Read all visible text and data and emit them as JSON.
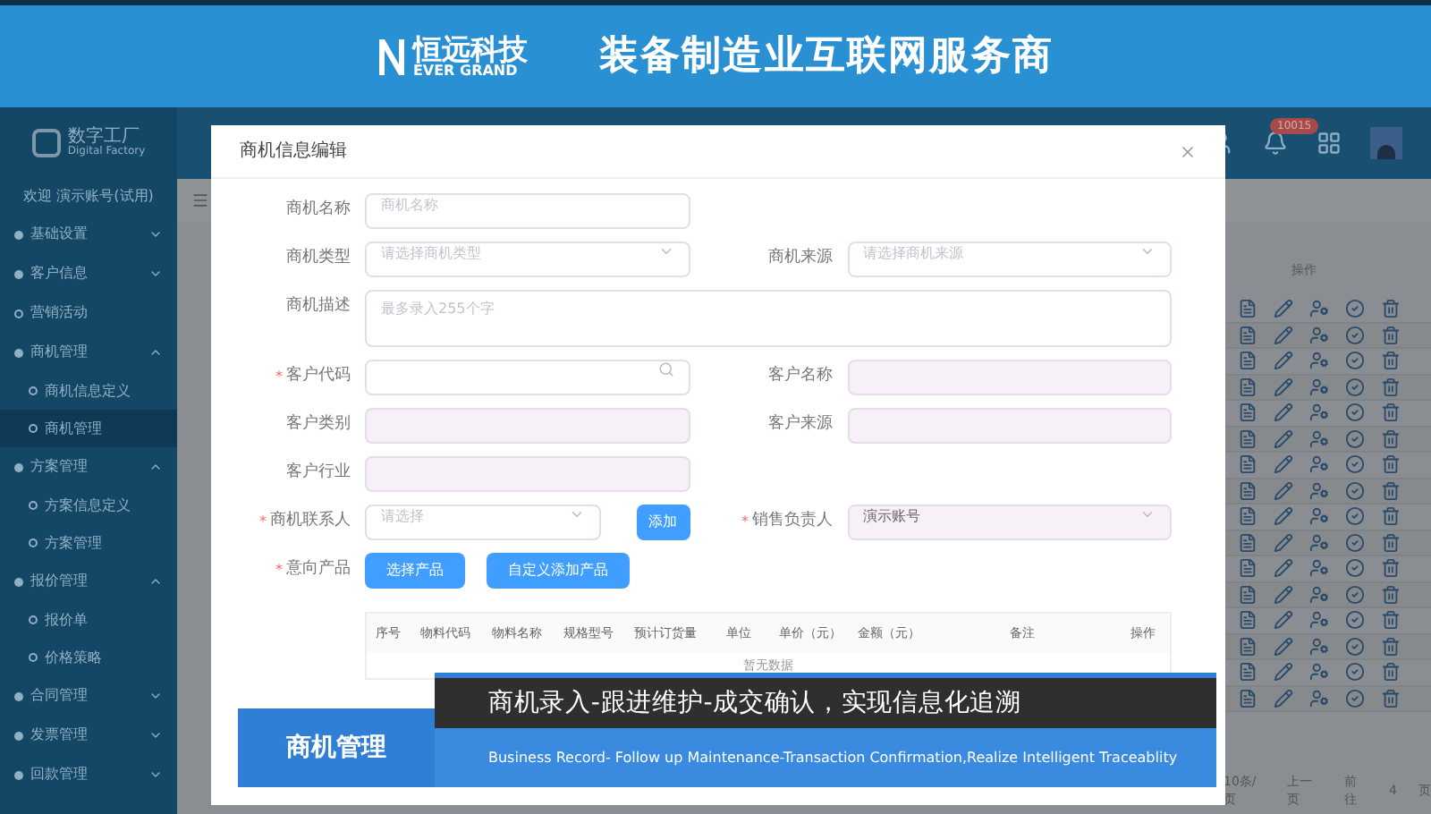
{
  "banner": {
    "logo_name": "恒远科技",
    "logo_sub": "EVER GRAND",
    "slogan": "装备制造业互联网服务商"
  },
  "app": {
    "name": "数字工厂",
    "name_en": "Digital Factory",
    "welcome": "欢迎 演示账号(试用)"
  },
  "header": {
    "badge": "10015"
  },
  "sidebar": {
    "items": [
      {
        "label": "基础设置",
        "expanded": false
      },
      {
        "label": "客户信息",
        "expanded": false
      },
      {
        "label": "营销活动",
        "kind": "leaf"
      },
      {
        "label": "商机管理",
        "expanded": true,
        "children": [
          {
            "label": "商机信息定义",
            "selected": false
          },
          {
            "label": "商机管理",
            "selected": true
          }
        ]
      },
      {
        "label": "方案管理",
        "expanded": true,
        "children": [
          {
            "label": "方案信息定义",
            "selected": false
          },
          {
            "label": "方案管理",
            "selected": false
          }
        ]
      },
      {
        "label": "报价管理",
        "expanded": true,
        "children": [
          {
            "label": "报价单",
            "selected": false
          },
          {
            "label": "价格策略",
            "selected": false
          }
        ]
      },
      {
        "label": "合同管理",
        "expanded": false
      },
      {
        "label": "发票管理",
        "expanded": false
      },
      {
        "label": "回款管理",
        "expanded": false
      }
    ]
  },
  "list": {
    "action_header": "操作",
    "pagination": {
      "page_size": "10条/页",
      "prev": "上一页",
      "goto": "前往",
      "page": "4",
      "page_suffix": "页"
    }
  },
  "dialog": {
    "title": "商机信息编辑",
    "rows": [
      [
        {
          "kind": "input",
          "label": "商机名称",
          "placeholder": "商机名称",
          "disabled": false
        }
      ],
      [
        {
          "kind": "select",
          "label": "商机类型",
          "placeholder": "请选择商机类型",
          "disabled": false
        },
        {
          "kind": "select",
          "label": "商机来源",
          "placeholder": "请选择商机来源",
          "disabled": false
        }
      ],
      [
        {
          "kind": "textarea",
          "label": "商机描述",
          "placeholder": "最多录入255个字",
          "disabled": false
        }
      ],
      [
        {
          "kind": "search",
          "label": "客户代码",
          "required": "*",
          "disabled": false
        },
        {
          "kind": "input",
          "label": "客户名称",
          "disabled": true
        }
      ],
      [
        {
          "kind": "input",
          "label": "客户类别",
          "disabled": true
        },
        {
          "kind": "input",
          "label": "客户来源",
          "disabled": true
        }
      ],
      [
        {
          "kind": "input",
          "label": "客户行业",
          "disabled": true
        }
      ],
      [
        {
          "kind": "select",
          "label": "商机联系人",
          "placeholder": "请选择",
          "required": "*",
          "disabled": false,
          "button": "添加"
        },
        {
          "kind": "select",
          "label": "销售负责人",
          "value": "演示账号",
          "required": "*",
          "disabled": true
        }
      ],
      [
        {
          "kind": "buttons",
          "label": "意向产品",
          "required": "*",
          "buttons": [
            "选择产品",
            "自定义添加产品"
          ]
        }
      ]
    ],
    "table": {
      "columns": [
        "序号",
        "物料代码",
        "物料名称",
        "规格型号",
        "预计订货量",
        "单位",
        "单价（元）",
        "金额（元）",
        "备注",
        "操作"
      ],
      "empty": "暂无数据"
    }
  },
  "caption": {
    "tag": "商机管理",
    "title": "商机录入-跟进维护-成交确认，实现信息化追溯",
    "subtitle": "Business Record- Follow up Maintenance-Transaction Confirmation,Realize Intelligent  Traceablity"
  }
}
